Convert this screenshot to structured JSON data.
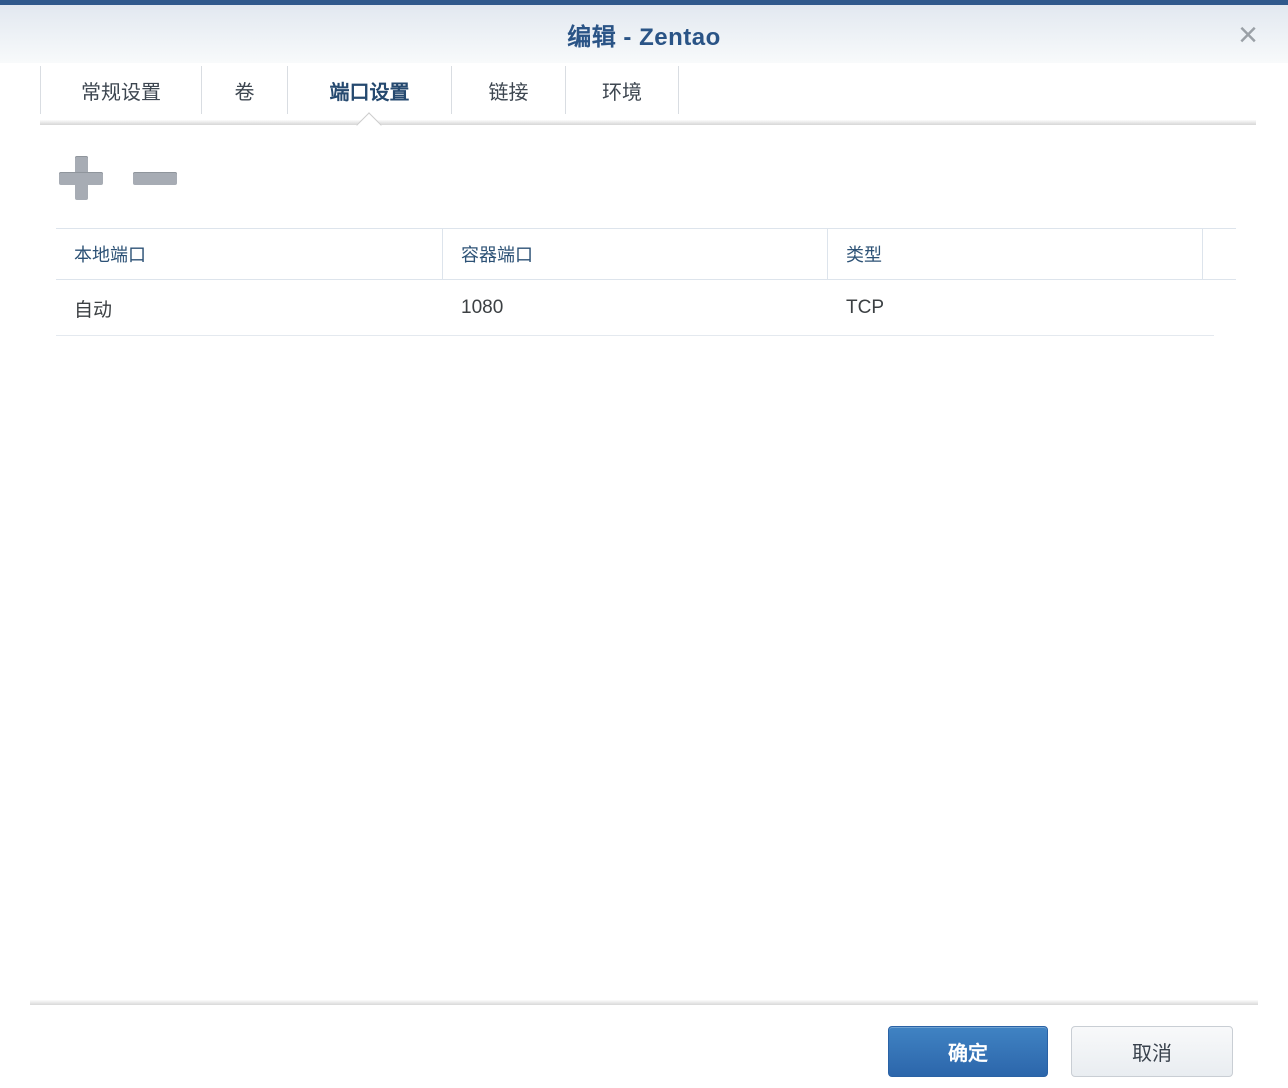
{
  "title_bar": {
    "title": "编辑 - Zentao",
    "close_icon": "×"
  },
  "tabs": [
    {
      "label": "常规设置",
      "active": false
    },
    {
      "label": "卷",
      "active": false
    },
    {
      "label": "端口设置",
      "active": true
    },
    {
      "label": "链接",
      "active": false
    },
    {
      "label": "环境",
      "active": false
    }
  ],
  "toolbar": {
    "add_icon": "plus-icon",
    "remove_icon": "minus-icon"
  },
  "port_table": {
    "columns": [
      "本地端口",
      "容器端口",
      "类型"
    ],
    "rows": [
      {
        "local_port": "自动",
        "container_port": "1080",
        "type": "TCP"
      }
    ]
  },
  "footer": {
    "ok_label": "确定",
    "cancel_label": "取消"
  },
  "colors": {
    "accent_blue": "#30598C",
    "title_text": "#2A5486",
    "header_text": "#2D5276",
    "ok_button_top": "#4083C3",
    "ok_button_bottom": "#2C66AB"
  }
}
